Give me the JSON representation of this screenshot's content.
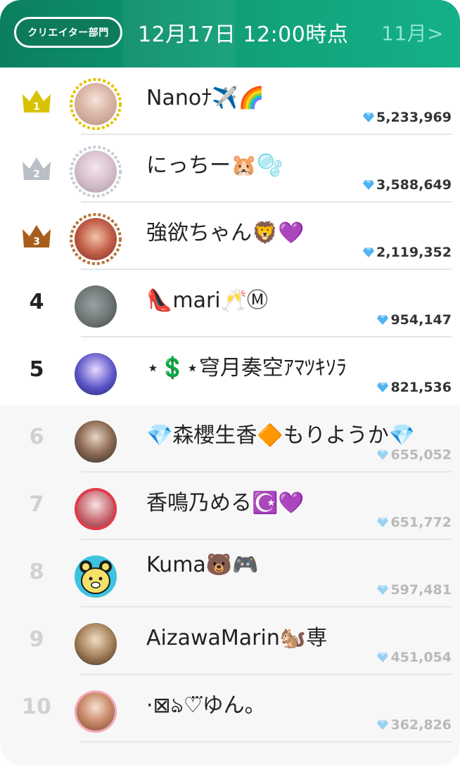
{
  "header": {
    "category_label": "クリエイター部門",
    "date_label": "12月17日 12:00時点",
    "next_month_label": "11月>"
  },
  "colors": {
    "header_start": "#0b7f5f",
    "header_end": "#14b08a",
    "gold": "#d8c300",
    "silver": "#b9bec7",
    "bronze": "#a65f1c"
  },
  "rankings": [
    {
      "rank": "1",
      "name": "Nanoﾅ✈️🌈",
      "score": "5,233,969",
      "medal": "gold"
    },
    {
      "rank": "2",
      "name": "にっちー🐹🫧",
      "score": "3,588,649",
      "medal": "silver"
    },
    {
      "rank": "3",
      "name": "強欲ちゃん🦁💜",
      "score": "2,119,352",
      "medal": "bronze"
    },
    {
      "rank": "4",
      "name": "👠mari🥂Ⓜ",
      "score": "954,147",
      "medal": ""
    },
    {
      "rank": "5",
      "name": "⋆💲⋆穹月奏空ｱﾏﾂｷｿﾗ",
      "score": "821,536",
      "medal": ""
    },
    {
      "rank": "6",
      "name": "💎森櫻生香🔶もりようか💎",
      "score": "655,052",
      "medal": ""
    },
    {
      "rank": "7",
      "name": "香鳴乃める☪️💜",
      "score": "651,772",
      "medal": ""
    },
    {
      "rank": "8",
      "name": "Kuma🐻🎮",
      "score": "597,481",
      "medal": ""
    },
    {
      "rank": "9",
      "name": "AizawaMarin🐿️専",
      "score": "451,054",
      "medal": ""
    },
    {
      "rank": "10",
      "name": "·⊠ঌ♡⃛ゆん。",
      "score": "362,826",
      "medal": ""
    }
  ]
}
